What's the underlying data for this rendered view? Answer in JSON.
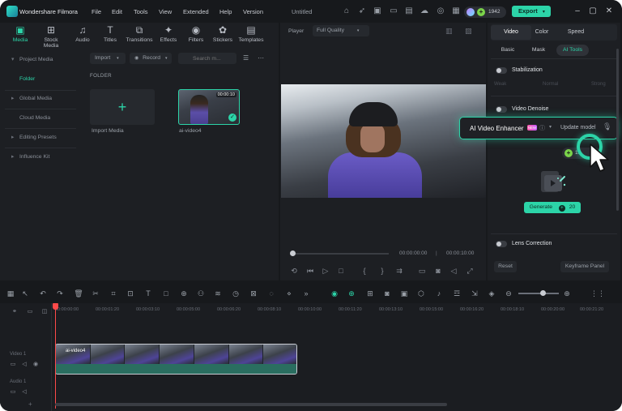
{
  "app": {
    "name": "Wondershare Filmora",
    "doc_title": "Untitled",
    "menu": [
      "File",
      "Edit",
      "Tools",
      "View",
      "Extended",
      "Help",
      "Version"
    ],
    "credits": "1942",
    "export_label": "Export"
  },
  "media_tabs": [
    {
      "label": "Media",
      "icon": "media-icon"
    },
    {
      "label": "Stock Media",
      "icon": "stock-media-icon"
    },
    {
      "label": "Audio",
      "icon": "audio-icon"
    },
    {
      "label": "Titles",
      "icon": "titles-icon"
    },
    {
      "label": "Transitions",
      "icon": "transitions-icon"
    },
    {
      "label": "Effects",
      "icon": "effects-icon"
    },
    {
      "label": "Filters",
      "icon": "filters-icon"
    },
    {
      "label": "Stickers",
      "icon": "stickers-icon"
    },
    {
      "label": "Templates",
      "icon": "templates-icon"
    }
  ],
  "sidebar": {
    "items": [
      {
        "label": "Project Media"
      },
      {
        "label": "Folder"
      },
      {
        "label": "Global Media"
      },
      {
        "label": "Cloud Media"
      },
      {
        "label": "Editing Presets"
      },
      {
        "label": "Influence Kit"
      }
    ]
  },
  "media_toolbar": {
    "import_label": "Import",
    "record_label": "Record",
    "search_placeholder": "Search m..."
  },
  "library": {
    "folder_label": "FOLDER",
    "import_tile_label": "Import Media",
    "video_tile_label": "ai-video4",
    "video_duration": "00:00:10"
  },
  "player": {
    "label": "Player",
    "quality": "Full Quality",
    "current_time": "00:00:00:00",
    "total_time": "00:00:10:00"
  },
  "properties": {
    "tabs": [
      "Video",
      "Color",
      "Speed"
    ],
    "subtabs": [
      "Basic",
      "Mask",
      "AI Tools"
    ],
    "stabilization_label": "Stabilization",
    "stab_levels": [
      "Weak",
      "Normal",
      "Strong"
    ],
    "denoise_label": "Video Denoise",
    "ai_enhancer": {
      "title": "AI Video Enhancer",
      "badge": "NEW",
      "update_label": "Update model"
    },
    "seg_credits": "15",
    "generate_label": "Generate",
    "generate_cost": "20",
    "lens_label": "Lens Correction",
    "reset_label": "Reset",
    "keyframe_label": "Keyframe Panel"
  },
  "timeline": {
    "ruler": [
      "00:00:00:00",
      "00:00:01:20",
      "00:00:03:10",
      "00:00:05:00",
      "00:00:06:20",
      "00:00:08:10",
      "00:00:10:00",
      "00:00:11:20",
      "00:00:13:10",
      "00:00:15:00",
      "00:00:16:20",
      "00:00:18:10",
      "00:00:20:00",
      "00:00:21:20"
    ],
    "clip_name": "ai-video4",
    "video_track_label": "Video 1",
    "audio_track_label": "Audio 1"
  },
  "colors": {
    "accent": "#2cd4a8",
    "background": "#17191c",
    "panel": "#1d1f23",
    "playhead": "#ff4a4a"
  }
}
